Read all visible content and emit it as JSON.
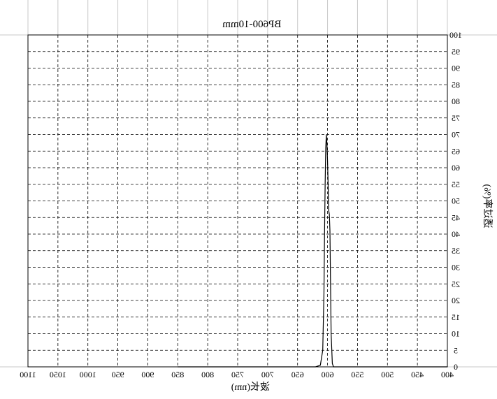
{
  "chart_data": {
    "type": "line",
    "title": "BP600-10mm",
    "xlabel": "波长(nm)",
    "ylabel": "透过率(%)",
    "x_reversed": true,
    "mirrored_text": true,
    "xlim": [
      400,
      1100
    ],
    "ylim": [
      0,
      100
    ],
    "x_ticks": [
      1100,
      1050,
      1000,
      950,
      900,
      850,
      800,
      750,
      700,
      650,
      600,
      550,
      500,
      450,
      400
    ],
    "y_ticks": [
      0,
      5,
      10,
      15,
      20,
      25,
      30,
      35,
      40,
      45,
      50,
      55,
      60,
      65,
      70,
      75,
      80,
      85,
      90,
      95,
      100
    ],
    "grid": true,
    "line_color": "#000000",
    "series": [
      {
        "x": [
          850,
          800,
          700,
          620,
          612,
          608,
          606,
          605,
          604,
          603,
          602,
          601,
          600,
          599,
          598,
          597,
          596,
          595,
          594,
          592,
          590,
          585,
          550,
          500,
          400
        ],
        "y": [
          0,
          0,
          0,
          0,
          0.5,
          5,
          22,
          40,
          55,
          66,
          70,
          67,
          62,
          55,
          47,
          46,
          41,
          25,
          10,
          1,
          0,
          0,
          0,
          0,
          0
        ]
      }
    ]
  }
}
